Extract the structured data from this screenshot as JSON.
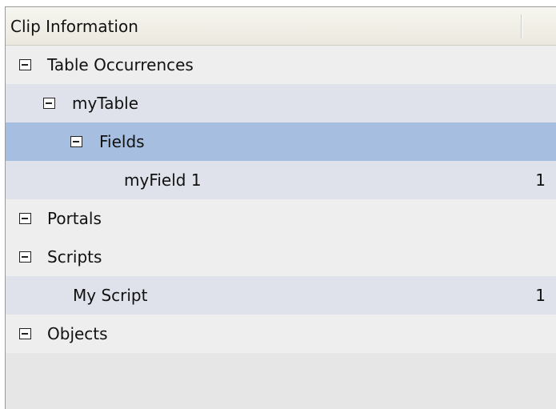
{
  "panel": {
    "title": "Clip Information"
  },
  "tree": {
    "table_occurrences": "Table Occurrences",
    "my_table": "myTable",
    "fields": "Fields",
    "my_field": "myField 1",
    "my_field_count": "1",
    "portals": "Portals",
    "scripts": "Scripts",
    "my_script": "My Script",
    "my_script_count": "1",
    "objects": "Objects"
  },
  "icons": {
    "toggle": "collapse-minus-icon"
  },
  "colors": {
    "selected_row": "#a6bedf",
    "row_light": "#eeeeee",
    "row_blue": "#dfe2ea"
  }
}
